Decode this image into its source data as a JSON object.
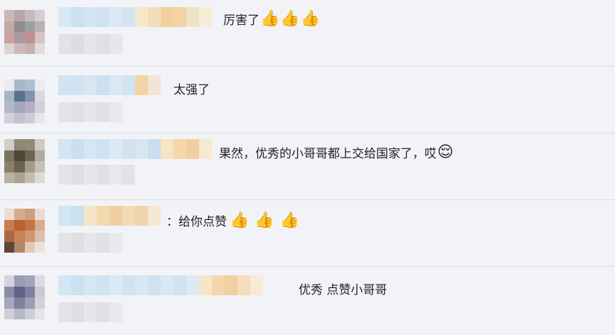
{
  "comments": [
    {
      "text": "厉害了",
      "emojis": [
        "👍",
        "👍",
        "👍"
      ]
    },
    {
      "text": "太强了",
      "emojis": []
    },
    {
      "text": "果然，优秀的小哥哥都上交给国家了，哎",
      "emojis": [
        "😌"
      ]
    },
    {
      "text": "：给你点赞",
      "emojis": [
        "👍",
        "👍",
        "👍"
      ]
    },
    {
      "text": "优秀 点赞小哥哥",
      "emojis": []
    }
  ]
}
